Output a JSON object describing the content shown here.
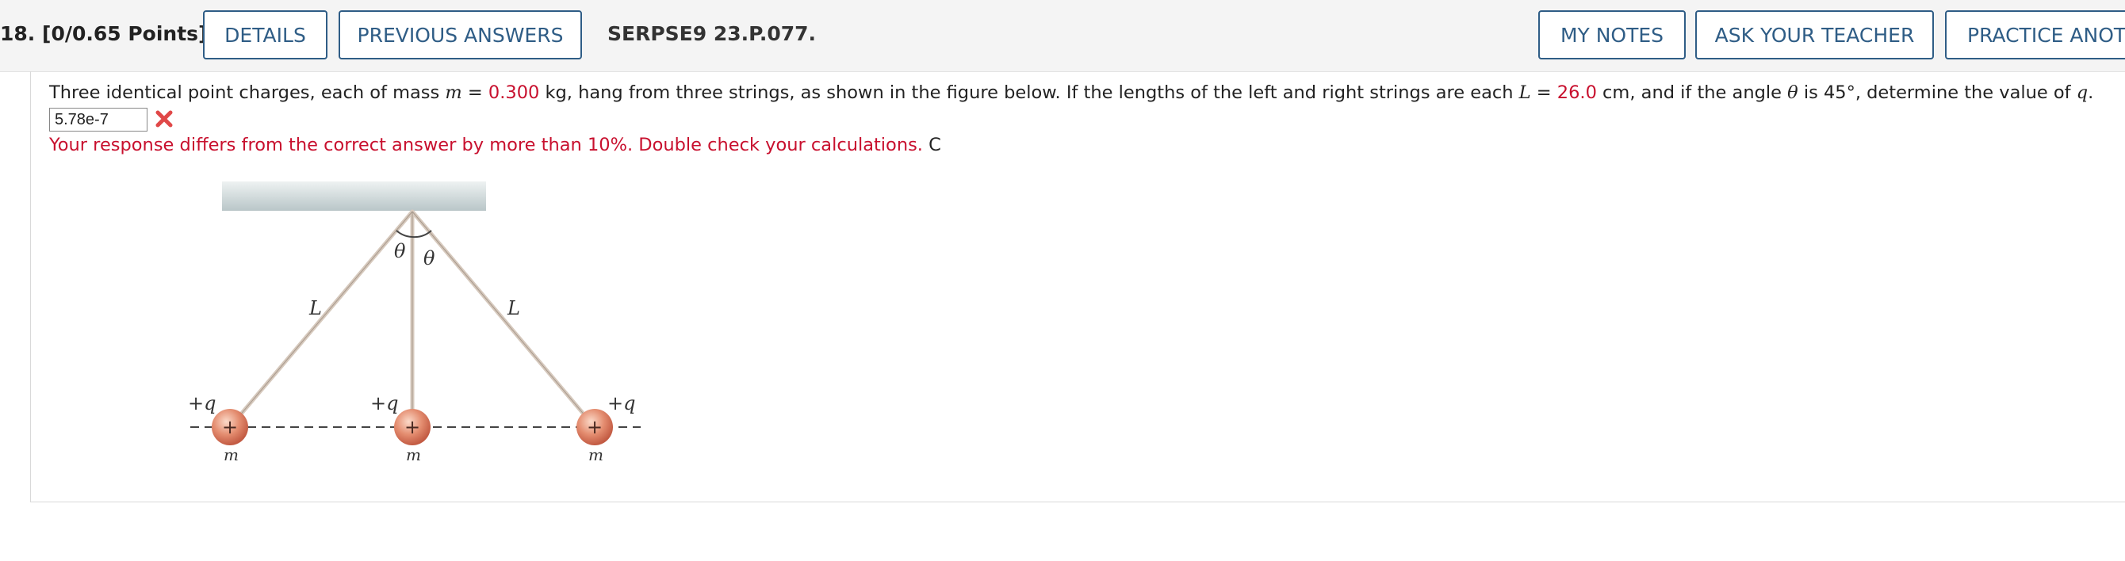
{
  "question": {
    "number": "18.",
    "points": "[0/0.65 Points]",
    "code": "SERPSE9 23.P.077."
  },
  "header_buttons": {
    "details": "DETAILS",
    "previous_answers": "PREVIOUS ANSWERS",
    "my_notes": "MY NOTES",
    "ask_teacher": "ASK YOUR TEACHER",
    "practice": "PRACTICE ANOT"
  },
  "problem": {
    "t1": "Three identical point charges, each of mass ",
    "m_var": "m",
    "eq": " = ",
    "m_value": "0.300",
    "t2": " kg,  hang from three strings, as shown in the figure below. If the lengths of the left and right strings are each ",
    "L_var": "L",
    "eq2": " = ",
    "L_value": "26.0",
    "t3": " cm,  and if the angle ",
    "theta_var": "θ",
    "t4": " is 45°, determine the value of ",
    "q_var": "q",
    "t5": "."
  },
  "answer": {
    "value": "5.78e-7",
    "status": "incorrect",
    "feedback": "Your response differs from the correct answer by more than 10%. Double check your calculations.",
    "unit_suffix": "C"
  },
  "figure": {
    "string_label_left": "L",
    "string_label_right": "L",
    "angle_label_left": "θ",
    "angle_label_right": "θ",
    "charge_labels": [
      "+q",
      "+q",
      "+q"
    ],
    "charge_sign": "+",
    "mass_labels": [
      "m",
      "m",
      "m"
    ]
  },
  "colors": {
    "accent_button": "#2f5d86",
    "wrong": "#c8102e",
    "sphere": "#dd7a60"
  }
}
